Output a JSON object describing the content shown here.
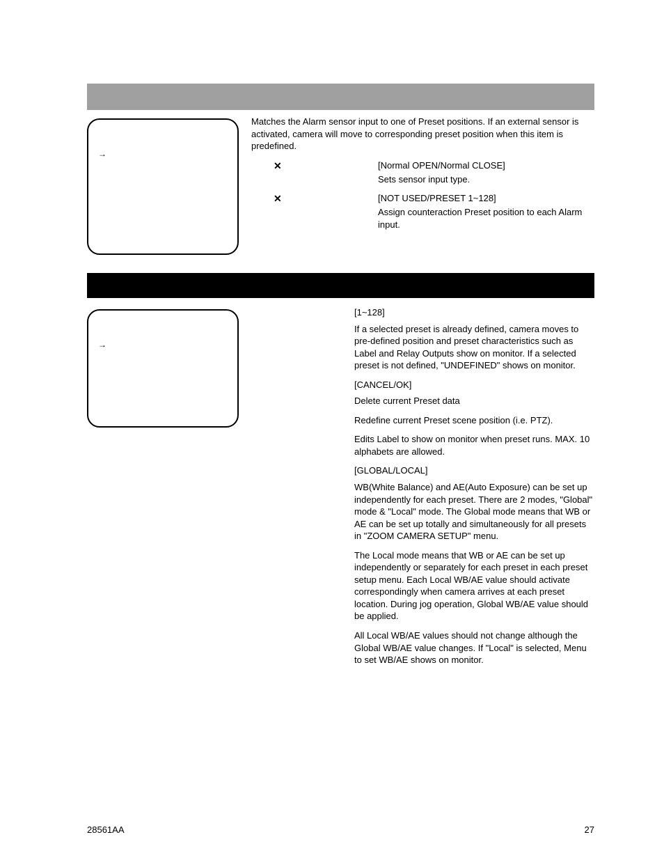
{
  "arrow_glyph": "→",
  "cross_glyph": "✕",
  "section1": {
    "intro": "Matches the Alarm sensor input to one of Preset positions. If an external sensor is activated, camera will move to corresponding preset position when this item is predefined.",
    "items": [
      {
        "option": "[Normal OPEN/Normal CLOSE]",
        "desc": "Sets sensor input type."
      },
      {
        "option": "[NOT USED/PRESET 1~128]",
        "desc": "Assign counteraction Preset position to each Alarm input."
      }
    ]
  },
  "section2": {
    "blocks": [
      {
        "option": "[1~128]",
        "desc": "If a selected preset is already defined, camera moves to pre-defined position and preset characteristics such as Label and Relay Outputs show on monitor. If a selected preset is not defined, \"UNDEFINED\" shows on monitor."
      },
      {
        "option": "[CANCEL/OK]",
        "desc": "Delete current Preset data"
      },
      {
        "option": "",
        "desc": "Redefine current Preset scene position (i.e. PTZ)."
      },
      {
        "option": "",
        "desc": "Edits Label to show on monitor when preset runs. MAX. 10 alphabets are allowed."
      },
      {
        "option": "[GLOBAL/LOCAL]",
        "desc": "WB(White Balance) and AE(Auto Exposure) can be set up independently for each preset. There are 2 modes, \"Global\" mode & \"Local\" mode. The Global mode means that WB or AE can be set up totally and simultaneously for all presets in \"ZOOM CAMERA SETUP\" menu."
      },
      {
        "option": "",
        "desc": "The Local mode means that WB or AE can be set up independently or separately for each preset in each preset setup menu. Each Local WB/AE value should activate correspondingly when camera arrives at each preset location. During jog operation, Global WB/AE value should be applied."
      },
      {
        "option": "",
        "desc": "All Local WB/AE values should not change although the Global WB/AE value changes. If \"Local\" is selected, Menu to set WB/AE shows on monitor."
      }
    ]
  },
  "footer": {
    "left": "28561AA",
    "right": "27"
  }
}
